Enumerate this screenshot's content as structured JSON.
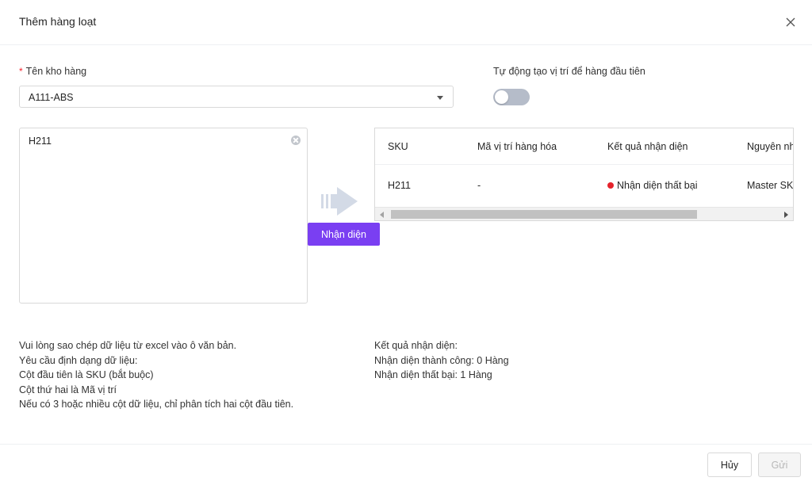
{
  "modal": {
    "title": "Thêm hàng loạt",
    "close_icon": "close-icon"
  },
  "form": {
    "warehouse_label": "Tên kho hàng",
    "warehouse_value": "A111-ABS",
    "auto_create_label": "Tự động tạo vị trí để hàng đầu tiên",
    "auto_create_enabled": false,
    "input_text": "H211"
  },
  "recognize_button": "Nhận diện",
  "table": {
    "headers": [
      "SKU",
      "Mã vị trí hàng hóa",
      "Kết quả nhận diện",
      "Nguyên nh"
    ],
    "rows": [
      {
        "sku": "H211",
        "location": "-",
        "result": "Nhận diện thất bại",
        "reason": "Master SK"
      }
    ],
    "status_color": "#e5232c"
  },
  "instructions": [
    "Vui lòng sao chép dữ liệu từ excel vào ô văn bản.",
    "Yêu cầu định dạng dữ liệu:",
    "Cột đầu tiên là SKU (bắt buộc)",
    "Cột thứ hai là Mã vị trí",
    "Nếu có 3 hoặc nhiều cột dữ liệu, chỉ phân tích hai cột đầu tiên."
  ],
  "result_summary": [
    "Kết quả nhận diện:",
    "Nhận diện thành công: 0 Hàng",
    "Nhận diện thất bại: 1 Hàng"
  ],
  "footer": {
    "cancel": "Hủy",
    "submit": "Gửi"
  },
  "colors": {
    "accent": "#7a3ff2",
    "required": "#f5222d"
  }
}
